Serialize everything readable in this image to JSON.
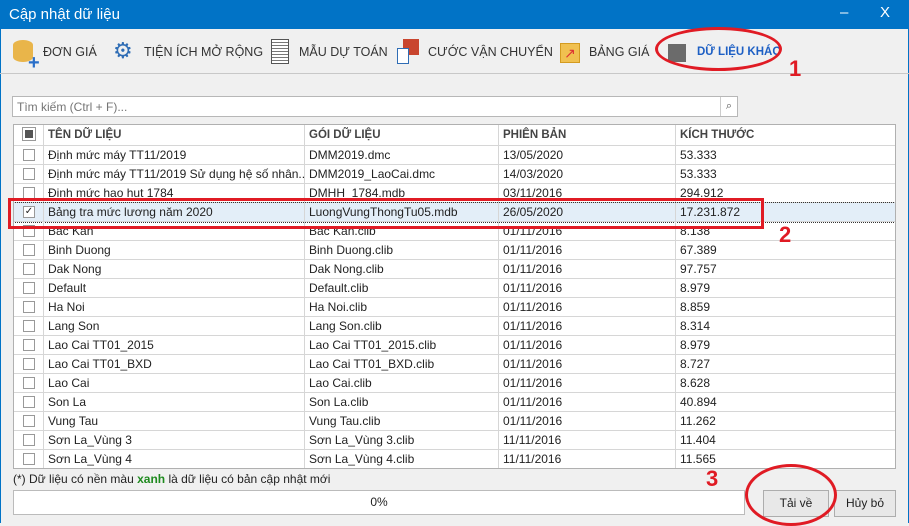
{
  "window": {
    "title": "Cập nhật dữ liệu",
    "minimize": "–",
    "close": "X"
  },
  "toolbar": [
    {
      "label": "ĐƠN GIÁ",
      "icon": "database-add-icon"
    },
    {
      "label": "TIỆN ÍCH MỞ RỘNG",
      "icon": "gears-icon"
    },
    {
      "label": "MẪU DỰ TOÁN",
      "icon": "document-icon"
    },
    {
      "label": "CƯỚC VẬN CHUYỂN",
      "icon": "presentation-icon"
    },
    {
      "label": "BẢNG GIÁ",
      "icon": "chart-icon"
    },
    {
      "label": "DỮ LIỆU KHÁC",
      "icon": "cabinet-icon",
      "active": true
    }
  ],
  "search": {
    "placeholder": "Tìm kiếm (Ctrl + F)...",
    "icon": "search-icon"
  },
  "table": {
    "headers": [
      "TÊN DỮ LIỆU",
      "GÓI DỮ LIỆU",
      "PHIÊN BẢN",
      "KÍCH THƯỚC"
    ],
    "rows": [
      {
        "name": "Định mức máy TT11/2019",
        "pkg": "DMM2019.dmc",
        "ver": "13/05/2020",
        "size": "53.333",
        "checked": false
      },
      {
        "name": "Định mức máy TT11/2019 Sử dụng hệ số nhân...",
        "pkg": "DMM2019_LaoCai.dmc",
        "ver": "14/03/2020",
        "size": "53.333",
        "checked": false
      },
      {
        "name": "Định mức hao hụt 1784",
        "pkg": "DMHH_1784.mdb",
        "ver": "03/11/2016",
        "size": "294.912",
        "checked": false
      },
      {
        "name": "Bảng tra mức lương năm 2020",
        "pkg": "LuongVungThongTu05.mdb",
        "ver": "26/05/2020",
        "size": "17.231.872",
        "checked": true,
        "selected": true
      },
      {
        "name": "Bac Kan",
        "pkg": "Bac Kan.clib",
        "ver": "01/11/2016",
        "size": "8.138",
        "checked": false
      },
      {
        "name": "Binh Duong",
        "pkg": "Binh Duong.clib",
        "ver": "01/11/2016",
        "size": "67.389",
        "checked": false
      },
      {
        "name": "Dak Nong",
        "pkg": "Dak Nong.clib",
        "ver": "01/11/2016",
        "size": "97.757",
        "checked": false
      },
      {
        "name": "Default",
        "pkg": "Default.clib",
        "ver": "01/11/2016",
        "size": "8.979",
        "checked": false
      },
      {
        "name": "Ha Noi",
        "pkg": "Ha Noi.clib",
        "ver": "01/11/2016",
        "size": "8.859",
        "checked": false
      },
      {
        "name": "Lang Son",
        "pkg": "Lang Son.clib",
        "ver": "01/11/2016",
        "size": "8.314",
        "checked": false
      },
      {
        "name": "Lao Cai TT01_2015",
        "pkg": "Lao Cai TT01_2015.clib",
        "ver": "01/11/2016",
        "size": "8.979",
        "checked": false
      },
      {
        "name": "Lao Cai TT01_BXD",
        "pkg": "Lao Cai TT01_BXD.clib",
        "ver": "01/11/2016",
        "size": "8.727",
        "checked": false
      },
      {
        "name": "Lao Cai",
        "pkg": "Lao Cai.clib",
        "ver": "01/11/2016",
        "size": "8.628",
        "checked": false
      },
      {
        "name": "Son La",
        "pkg": "Son La.clib",
        "ver": "01/11/2016",
        "size": "40.894",
        "checked": false
      },
      {
        "name": "Vung Tau",
        "pkg": "Vung Tau.clib",
        "ver": "01/11/2016",
        "size": "11.262",
        "checked": false
      },
      {
        "name": "Sơn La_Vùng 3",
        "pkg": "Sơn La_Vùng 3.clib",
        "ver": "11/11/2016",
        "size": "11.404",
        "checked": false
      },
      {
        "name": "Sơn La_Vùng 4",
        "pkg": "Sơn La_Vùng 4.clib",
        "ver": "11/11/2016",
        "size": "11.565",
        "checked": false
      }
    ]
  },
  "footer": {
    "note_pre": "(*) Dữ liệu có nền màu ",
    "note_bold": "xanh",
    "note_post": " là dữ liệu có bản cập nhật mới",
    "progress": "0%",
    "progress_value": 0,
    "download": "Tải về",
    "cancel": "Hủy bỏ"
  },
  "annotations": {
    "a1": "1",
    "a2": "2",
    "a3": "3",
    "color": "#e01b24"
  }
}
